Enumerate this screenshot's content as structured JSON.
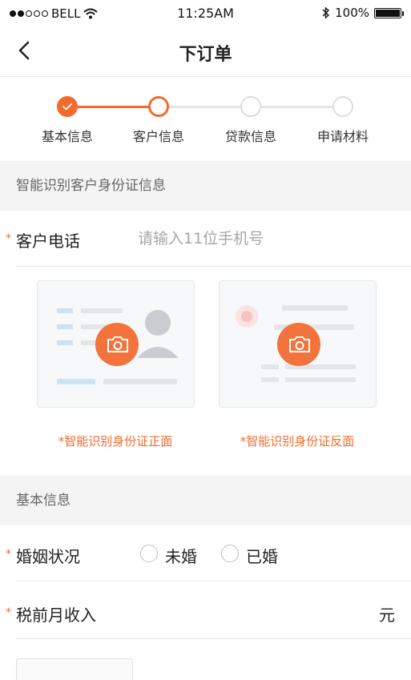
{
  "status_bar": {
    "carrier": "BELL",
    "time": "11:25AM",
    "battery": "100%",
    "signal_icon": "signal-dots-icon",
    "wifi_icon": "wifi-icon",
    "bluetooth_icon": "bluetooth-icon"
  },
  "nav": {
    "title": "下订单",
    "back_icon": "chevron-left-icon"
  },
  "steps": [
    {
      "label": "基本信息",
      "state": "done"
    },
    {
      "label": "客户信息",
      "state": "current"
    },
    {
      "label": "贷款信息",
      "state": "todo"
    },
    {
      "label": "申请材料",
      "state": "todo"
    }
  ],
  "sections": {
    "id_recognition": "智能识别客户身份证信息",
    "basic_info": "基本信息"
  },
  "form": {
    "required_mark": "*",
    "phone": {
      "label": "客户电话",
      "placeholder": "请输入11位手机号",
      "value": ""
    },
    "marital": {
      "label": "婚姻状况",
      "options": [
        "未婚",
        "已婚"
      ],
      "selected": null
    },
    "income": {
      "label": "税前月收入",
      "unit": "元",
      "value": ""
    }
  },
  "id_cards": {
    "front_caption": "*智能识别身份证正面",
    "back_caption": "*智能识别身份证反面",
    "camera_icon": "camera-icon"
  },
  "colors": {
    "accent": "#f26b2c",
    "section_bg": "#f4f4f4",
    "placeholder": "#a6a6a6"
  }
}
